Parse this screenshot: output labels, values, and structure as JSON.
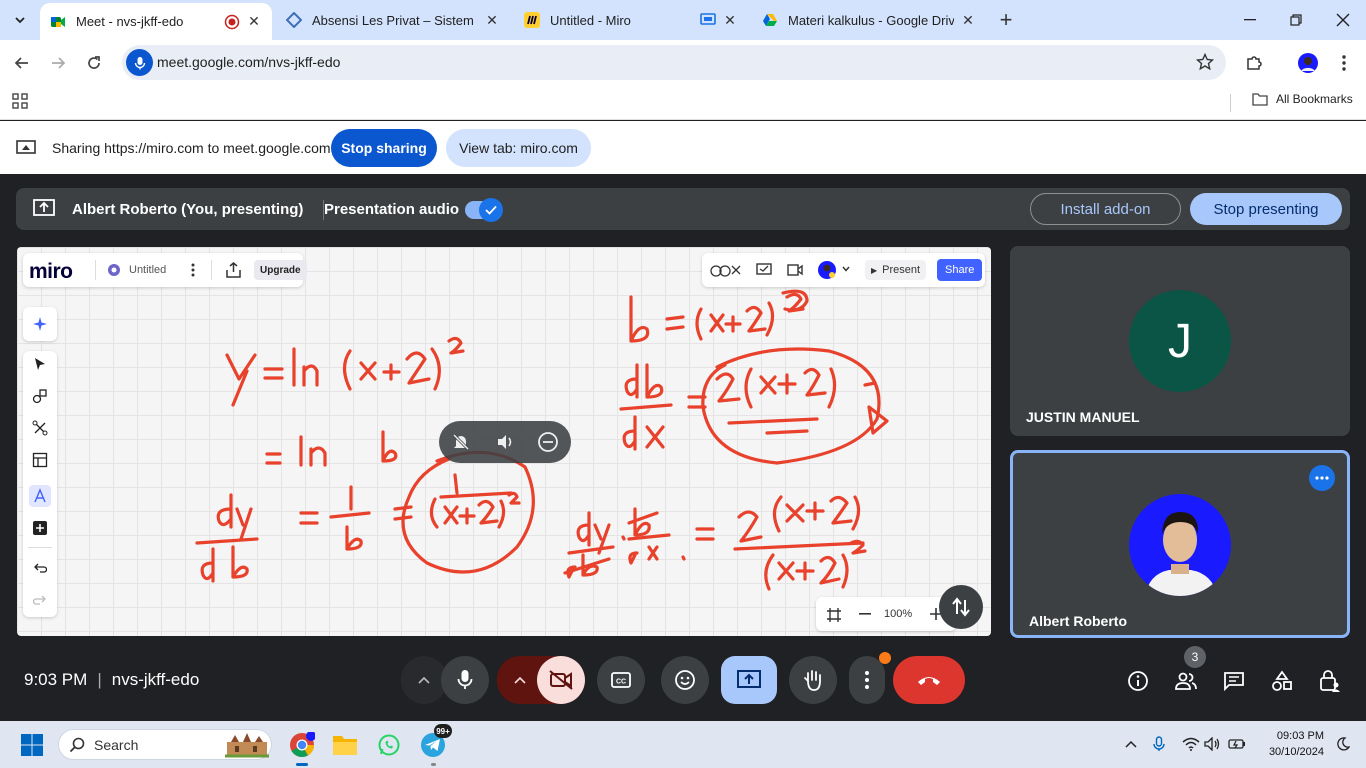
{
  "browser": {
    "tabs": [
      {
        "title": "Meet - nvs-jkff-edo",
        "active": true
      },
      {
        "title": "Absensi Les Privat – Sistem Ruang",
        "active": false
      },
      {
        "title": "Untitled - Miro",
        "active": false
      },
      {
        "title": "Materi kalkulus - Google Drive",
        "active": false
      }
    ],
    "url": "meet.google.com/nvs-jkff-edo",
    "bookmarks_label": "All Bookmarks"
  },
  "sharing_bar": {
    "message": "Sharing https://miro.com to meet.google.com",
    "stop_label": "Stop sharing",
    "view_tab_label": "View tab: miro.com"
  },
  "presentation": {
    "title": "Albert Roberto (You, presenting)",
    "audio_label": "Presentation audio",
    "audio_enabled": true,
    "install_addon_label": "Install add-on",
    "stop_presenting_label": "Stop presenting"
  },
  "miro": {
    "logo": "miro",
    "board_name": "Untitled",
    "upgrade_label": "Upgrade",
    "present_label": "Present",
    "share_label": "Share",
    "zoom": "100%",
    "ink_color": "#e8412c",
    "handwriting": {
      "line1": "y = ln (x+2)²",
      "line2": "= ln b",
      "line3": "dy/db = 1/b = 1/(x+2)²",
      "line4": "b = (x+2)²",
      "line5": "db/dx = 2(x+2)",
      "line6": "dy/db · db/dx = 2(x+2)/(x+2)²"
    }
  },
  "participants": [
    {
      "name": "JUSTIN MANUEL",
      "initial": "J",
      "avatar_color": "#0b5546"
    },
    {
      "name": "Albert Roberto",
      "avatar_color": "#1a1aff"
    }
  ],
  "meeting": {
    "time": "9:03 PM",
    "code": "nvs-jkff-edo",
    "participant_count": "3"
  },
  "taskbar": {
    "search_placeholder": "Search",
    "telegram_badge": "99+",
    "clock_time": "09:03 PM",
    "clock_date": "30/10/2024"
  }
}
